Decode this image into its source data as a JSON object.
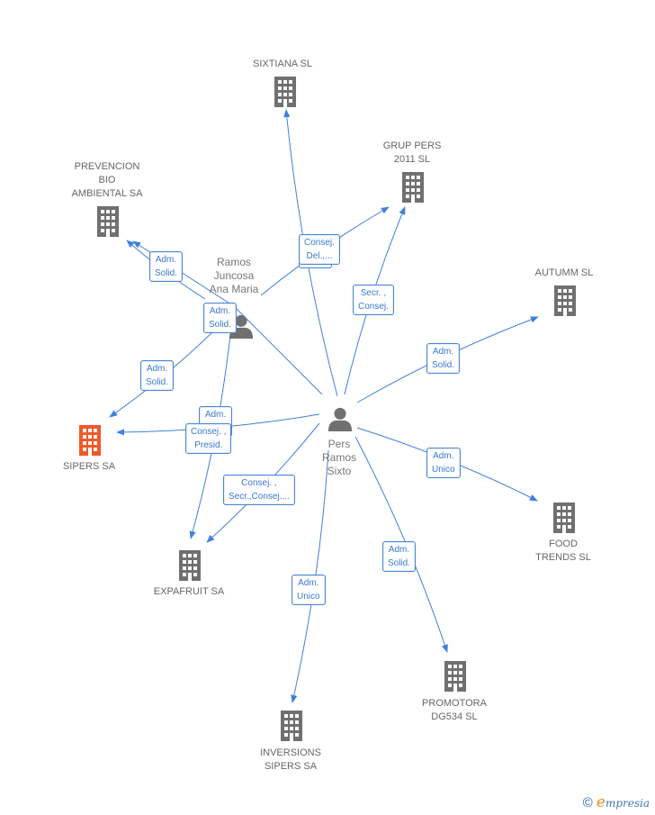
{
  "colors": {
    "edge": "#3f80dc",
    "building": "#707070",
    "highlight": "#f05a28",
    "person": "#707070"
  },
  "nodes": [
    {
      "id": "pers",
      "type": "person",
      "label": "Pers\nRamos\nSixto"
    },
    {
      "id": "ramos",
      "type": "person",
      "label": "Ramos\nJuncosa\nAna Maria"
    },
    {
      "id": "sixtiana",
      "type": "company",
      "label": "SIXTIANA SL"
    },
    {
      "id": "grup",
      "type": "company",
      "label": "GRUP PERS\n2011 SL"
    },
    {
      "id": "prevencion",
      "type": "company",
      "label": "PREVENCION\nBIO\nAMBIENTAL SA"
    },
    {
      "id": "autumm",
      "type": "company",
      "label": "AUTUMM SL"
    },
    {
      "id": "sipers",
      "type": "company",
      "label": "SIPERS SA",
      "highlight": true
    },
    {
      "id": "food",
      "type": "company",
      "label": "FOOD\nTRENDS  SL"
    },
    {
      "id": "expafruit",
      "type": "company",
      "label": "EXPAFRUIT SA"
    },
    {
      "id": "promotora",
      "type": "company",
      "label": "PROMOTORA\nDG534 SL"
    },
    {
      "id": "inversions",
      "type": "company",
      "label": "INVERSIONS\nSIPERS SA"
    }
  ],
  "edges": [
    {
      "from": "pers",
      "to": "sixtiana",
      "label": "Adm.\nSolid."
    },
    {
      "from": "ramos",
      "to": "grup",
      "label": "Consej.\nDel.,..."
    },
    {
      "from": "pers",
      "to": "grup",
      "label": "Secr. ,\nConsej."
    },
    {
      "from": "ramos",
      "to": "prevencion",
      "label": "Adm.\nSolid."
    },
    {
      "from": "pers",
      "to": "prevencion",
      "label": "Adm.\nSolid."
    },
    {
      "from": "ramos",
      "to": "sipers",
      "label": "Adm.\nSolid."
    },
    {
      "from": "pers",
      "to": "sipers",
      "label": "Adm.\nSolid."
    },
    {
      "from": "ramos",
      "to": "expafruit",
      "label": "Consej. ,\nPresid."
    },
    {
      "from": "pers",
      "to": "expafruit",
      "label": "Consej. ,\nSecr.,Consej...."
    },
    {
      "from": "pers",
      "to": "autumm",
      "label": "Adm.\nSolid."
    },
    {
      "from": "pers",
      "to": "food",
      "label": "Adm.\nUnico"
    },
    {
      "from": "pers",
      "to": "promotora",
      "label": "Adm.\nSolid."
    },
    {
      "from": "pers",
      "to": "inversions",
      "label": "Adm.\nUnico"
    }
  ],
  "footer": {
    "copyright": "©",
    "brand_initial": "e",
    "brand_rest": "mpresia"
  }
}
